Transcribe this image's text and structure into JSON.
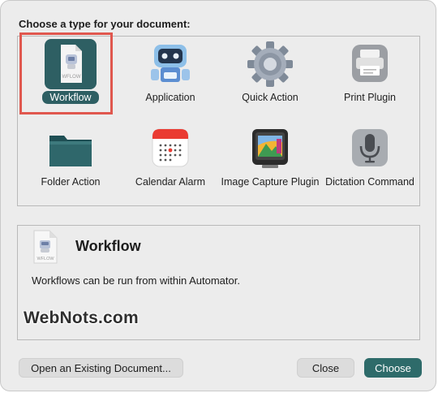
{
  "dialog": {
    "prompt": "Choose a type for your document:",
    "types": [
      {
        "label": "Workflow",
        "selected": true,
        "icon": "workflow-document-icon"
      },
      {
        "label": "Application",
        "selected": false,
        "icon": "automator-robot-icon"
      },
      {
        "label": "Quick Action",
        "selected": false,
        "icon": "gear-icon"
      },
      {
        "label": "Print Plugin",
        "selected": false,
        "icon": "printer-icon"
      },
      {
        "label": "Folder Action",
        "selected": false,
        "icon": "folder-icon"
      },
      {
        "label": "Calendar Alarm",
        "selected": false,
        "icon": "calendar-icon"
      },
      {
        "label": "Image Capture Plugin",
        "selected": false,
        "icon": "image-capture-icon"
      },
      {
        "label": "Dictation Command",
        "selected": false,
        "icon": "microphone-icon"
      }
    ],
    "description": {
      "title": "Workflow",
      "text": "Workflows can be run from within Automator.",
      "icon_caption": "WFLOW"
    },
    "buttons": {
      "open_existing": "Open an Existing Document...",
      "close": "Close",
      "choose": "Choose"
    }
  },
  "watermark": "WebNots.com",
  "colors": {
    "accent": "#2e6b6a",
    "selection_tile": "#2e5f63",
    "highlight": "#e0574e"
  }
}
